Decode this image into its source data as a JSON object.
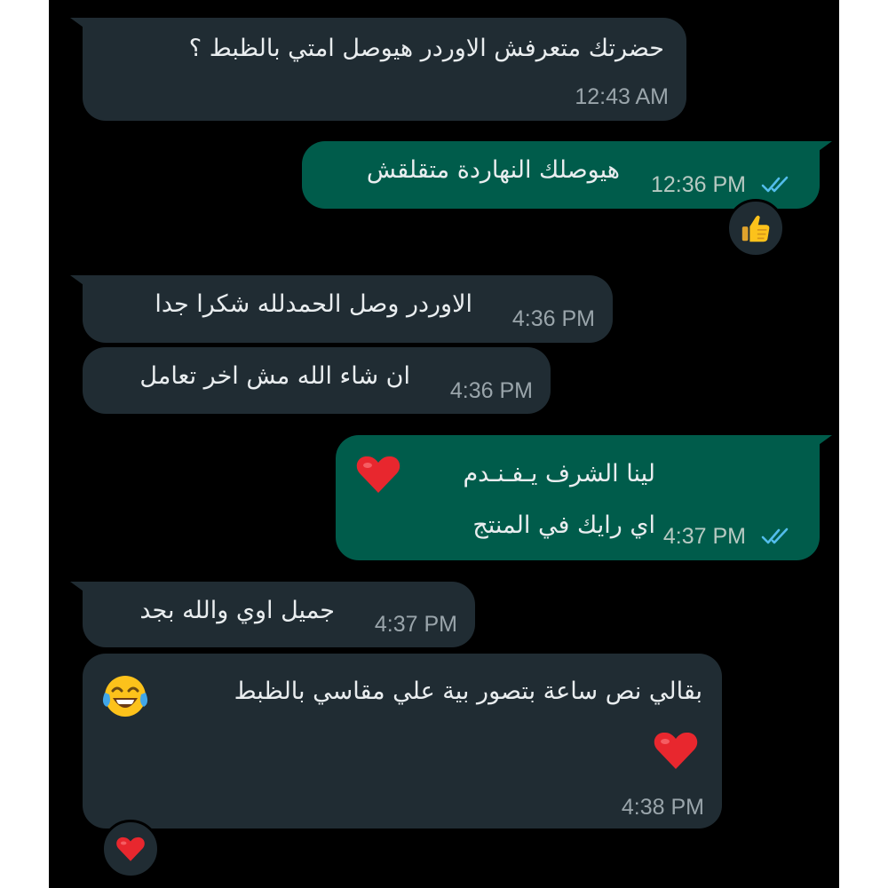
{
  "messages": [
    {
      "id": "m1",
      "direction": "incoming",
      "text": "حضرتك متعرفش الاوردر هيوصل امتي بالظبط ؟",
      "time": "12:43 AM"
    },
    {
      "id": "m2",
      "direction": "outgoing",
      "text": "هيوصلك النهاردة متقلقش",
      "time": "12:36 PM",
      "status_icon": "double-check-icon",
      "reaction_icon": "thumbs-up-icon"
    },
    {
      "id": "m3",
      "direction": "incoming",
      "text": "الاوردر وصل الحمدلله شكرا جدا",
      "time": "4:36 PM"
    },
    {
      "id": "m4",
      "direction": "incoming",
      "text": "ان شاء الله مش اخر تعامل",
      "time": "4:36 PM"
    },
    {
      "id": "m5",
      "direction": "outgoing",
      "line1": "لينا الشرف يـفـنـدم",
      "line1_icon": "red-heart-icon",
      "line2": "اي رايك في المنتج",
      "time": "4:37 PM",
      "status_icon": "double-check-icon"
    },
    {
      "id": "m6",
      "direction": "incoming",
      "text": "جميل اوي والله بجد",
      "time": "4:37 PM"
    },
    {
      "id": "m7",
      "direction": "incoming",
      "text": "بقالي نص ساعة بتصور بية علي مقاسي بالظبط",
      "text_icon": "tears-of-joy-icon",
      "line2_icon": "red-heart-icon",
      "time": "4:38 PM",
      "reaction_icon": "red-heart-icon"
    }
  ],
  "colors": {
    "background": "#000000",
    "incoming_bubble": "#202c33",
    "outgoing_bubble": "#005c4b",
    "read_ticks": "#53bdeb",
    "text": "#e9edef"
  }
}
